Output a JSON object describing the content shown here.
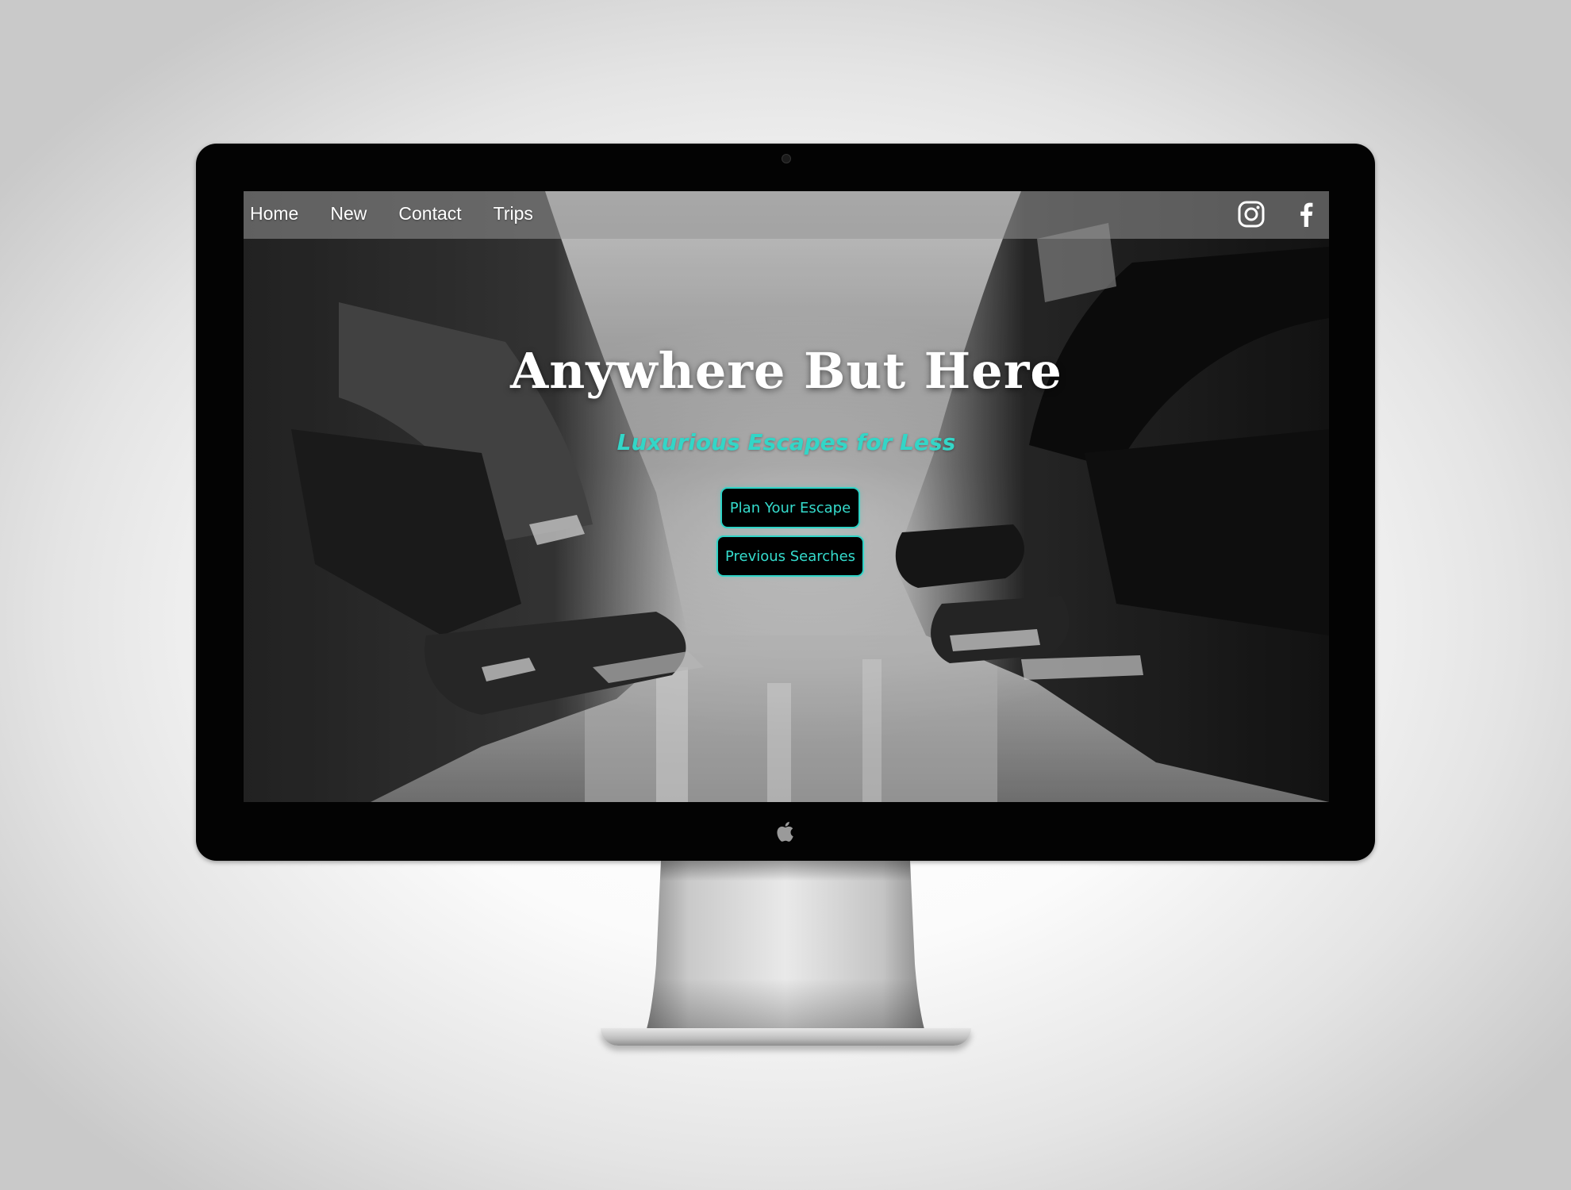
{
  "site": {
    "nav": {
      "items": [
        {
          "label": "Home"
        },
        {
          "label": "New"
        },
        {
          "label": "Contact"
        },
        {
          "label": "Trips"
        }
      ]
    },
    "social": [
      {
        "icon": "instagram-icon"
      },
      {
        "icon": "facebook-icon"
      }
    ],
    "hero": {
      "title": "Anywhere But Here",
      "tagline": "Luxurious Escapes for Less",
      "primary_button": "Plan Your Escape",
      "secondary_button": "Previous Searches"
    }
  },
  "colors": {
    "accent": "#33d6c7",
    "button_background": "#000000",
    "title": "#ffffff",
    "bezel": "#030303"
  }
}
